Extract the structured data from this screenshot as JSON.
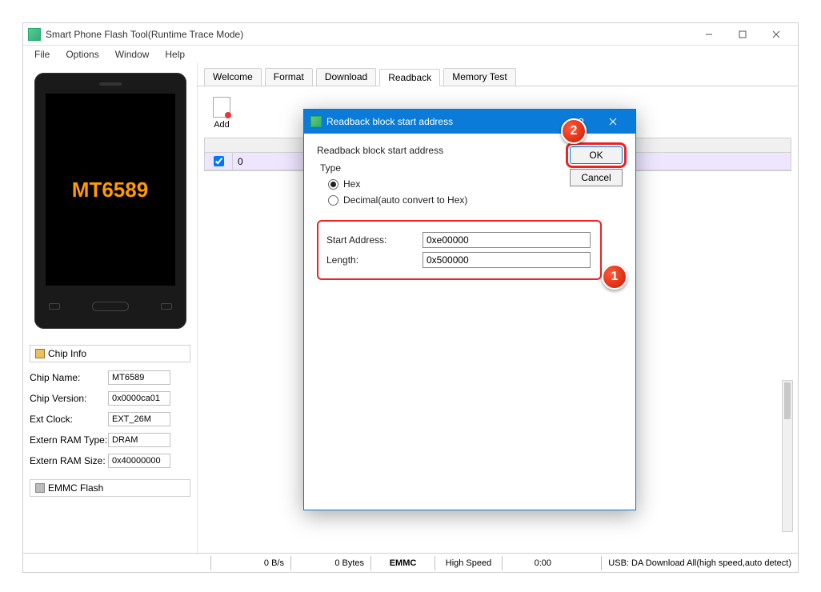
{
  "window": {
    "title": "Smart Phone Flash Tool(Runtime Trace Mode)"
  },
  "menu": {
    "file": "File",
    "options": "Options",
    "window": "Window",
    "help": "Help"
  },
  "phone": {
    "label": "MT6589"
  },
  "chipinfo": {
    "title": "Chip Info",
    "rows": {
      "chip_name_label": "Chip Name:",
      "chip_name": "MT6589",
      "chip_version_label": "Chip Version:",
      "chip_version": "0x0000ca01",
      "ext_clock_label": "Ext Clock:",
      "ext_clock": "EXT_26M",
      "ram_type_label": "Extern RAM Type:",
      "ram_type": "DRAM",
      "ram_size_label": "Extern RAM Size:",
      "ram_size": "0x40000000"
    }
  },
  "emmc": {
    "title": "EMMC Flash"
  },
  "tabs": {
    "welcome": "Welcome",
    "format": "Format",
    "download": "Download",
    "readback": "Readback",
    "memtest": "Memory Test"
  },
  "toolbar": {
    "add": "Add"
  },
  "table": {
    "cell0": "0"
  },
  "dialog": {
    "title": "Readback block start address",
    "heading": "Readback block start address",
    "type_label": "Type",
    "hex_label": "Hex",
    "dec_label": "Decimal(auto convert to Hex)",
    "start_label": "Start Address:",
    "start_value": "0xe00000",
    "length_label": "Length:",
    "length_value": "0x500000",
    "ok": "OK",
    "cancel": "Cancel",
    "help": "?"
  },
  "callouts": {
    "one": "1",
    "two": "2"
  },
  "status": {
    "rate": "0 B/s",
    "bytes": "0 Bytes",
    "storage": "EMMC",
    "speed": "High Speed",
    "time": "0:00",
    "usb": "USB: DA Download All(high speed,auto detect)"
  }
}
